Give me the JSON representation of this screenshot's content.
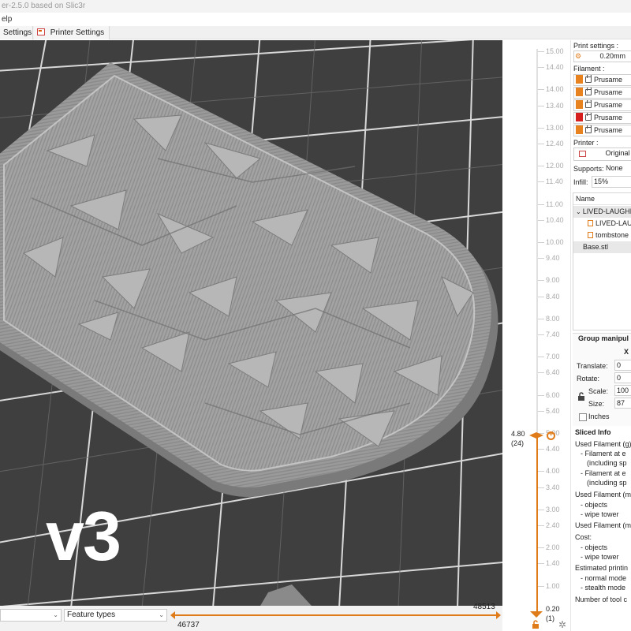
{
  "window": {
    "title": "er-2.5.0 based on Slic3r"
  },
  "menu": {
    "fragment": "elp"
  },
  "tabs": [
    {
      "label": "Settings"
    },
    {
      "label": "Printer Settings"
    }
  ],
  "viewport": {
    "overlay_text": "v3"
  },
  "bottom": {
    "view_combo": "",
    "feature_combo": "Feature types",
    "moves_max": "48513",
    "moves_current": "46737"
  },
  "layer_slider": {
    "ticks": [
      "15.00",
      "14.40",
      "14.00",
      "13.40",
      "13.00",
      "12.40",
      "12.00",
      "11.40",
      "11.00",
      "10.40",
      "10.00",
      "9.40",
      "9.00",
      "8.40",
      "8.00",
      "7.40",
      "7.00",
      "6.40",
      "6.00",
      "5.40",
      "5.00",
      "4.40",
      "4.00",
      "3.40",
      "3.00",
      "2.40",
      "2.00",
      "1.40",
      "1.00"
    ],
    "upper_value": "4.80",
    "upper_layer": "(24)",
    "lower_value": "0.20",
    "lower_layer": "(1)"
  },
  "panel": {
    "print_settings_label": "Print settings :",
    "print_settings_value": "0.20mm",
    "filament_label": "Filament :",
    "filaments": [
      {
        "name": "Prusame",
        "color": "#e8821e"
      },
      {
        "name": "Prusame",
        "color": "#e8821e"
      },
      {
        "name": "Prusame",
        "color": "#e8821e"
      },
      {
        "name": "Prusame",
        "color": "#d62020"
      },
      {
        "name": "Prusame",
        "color": "#e8821e"
      }
    ],
    "printer_label": "Printer :",
    "printer_value": "Original",
    "supports_label": "Supports:",
    "supports_value": "None",
    "infill_label": "Infill:",
    "infill_value": "15%",
    "tree_header": "Name",
    "tree_rows": [
      {
        "label": "LIVED-LAUGHE"
      },
      {
        "label": "LIVED-LAU"
      },
      {
        "label": "tombstone"
      },
      {
        "label": "Base.stl"
      }
    ],
    "group_title": "Group manipul",
    "axis_x": "X",
    "translate_label": "Translate:",
    "translate_x": "0",
    "rotate_label": "Rotate:",
    "rotate_x": "0",
    "scale_label": "Scale:",
    "scale_x": "100",
    "size_label": "Size:",
    "size_x": "87",
    "inches_label": "Inches",
    "sliced_title": "Sliced Info",
    "sliced_lines": [
      "Used Filament (g)",
      "- Filament at e",
      "(including sp",
      "- Filament at e",
      "(including sp",
      "Used Filament (m",
      "- objects",
      "- wipe tower",
      "Used Filament (m",
      "Cost:",
      "- objects",
      "- wipe tower",
      "Estimated printin",
      "- normal mode",
      "- stealth mode",
      "Number of tool c"
    ]
  },
  "colors": {
    "accent": "#e07b1a",
    "grid_bg": "#3f3f3f",
    "model": "#9c9c9c"
  }
}
